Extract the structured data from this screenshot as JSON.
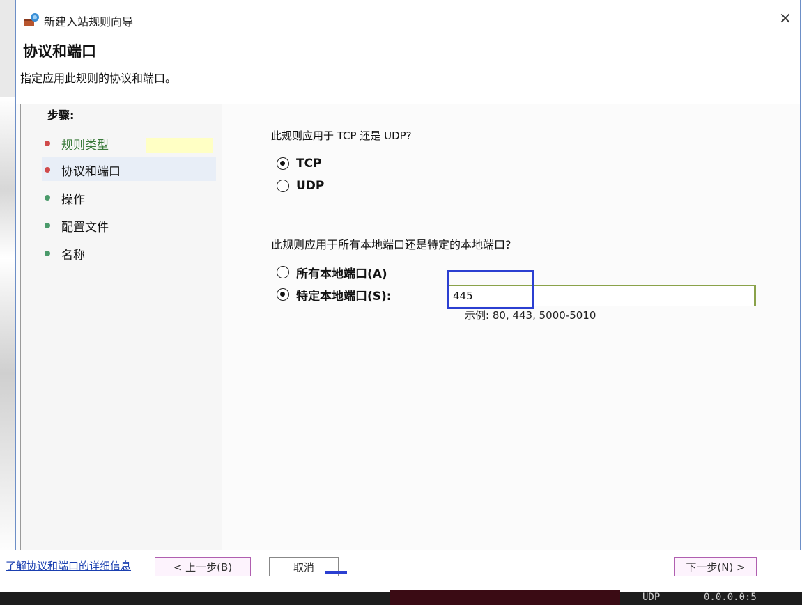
{
  "window": {
    "title": "新建入站规则向导",
    "close_glyph": "×"
  },
  "header": {
    "title": "协议和端口",
    "subtitle": "指定应用此规则的协议和端口。"
  },
  "steps": {
    "title": "步骤:",
    "items": [
      {
        "label": "规则类型",
        "dot_color": "#d04a4a"
      },
      {
        "label": "协议和端口",
        "dot_color": "#d04a4a"
      },
      {
        "label": "操作",
        "dot_color": "#4a9a6a"
      },
      {
        "label": "配置文件",
        "dot_color": "#4a9a6a"
      },
      {
        "label": "名称",
        "dot_color": "#4a9a6a"
      }
    ]
  },
  "main": {
    "protocol_question": "此规则应用于 TCP 还是 UDP?",
    "protocol_options": [
      {
        "label": "TCP",
        "selected": true
      },
      {
        "label": "UDP",
        "selected": false
      }
    ],
    "port_question": "此规则应用于所有本地端口还是特定的本地端口?",
    "port_options": [
      {
        "label": "所有本地端口(A)",
        "selected": false
      },
      {
        "label": "特定本地端口(S):",
        "selected": true
      }
    ],
    "port_value": "445",
    "example": "示例: 80, 443, 5000-5010"
  },
  "footer": {
    "help_link": "了解协议和端口的详细信息",
    "back_button": "< 上一步(B)",
    "next_button": "下一步(N) >",
    "cancel_button": "取消"
  },
  "taskbar": {
    "protocol": "UDP",
    "address": "0.0.0.0:5"
  },
  "colors": {
    "focus_border": "#2b3fd1",
    "input_border": "#8aa24a",
    "highlight": "#ffffc4"
  }
}
